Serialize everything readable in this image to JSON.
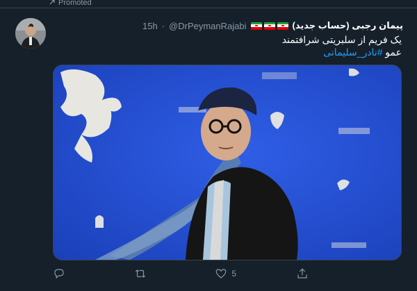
{
  "promoted": {
    "label": "Promoted"
  },
  "tweet": {
    "display_name": "پیمان رجبی (حساب جدید)",
    "handle": "@DrPeymanRajabi",
    "separator": "·",
    "time": "15h",
    "text_line1": "یک فریم از سلبریتی شرافتمند",
    "text_line2_prefix": "عمو ",
    "hashtag": "#نادر_سلیمانی",
    "like_count": "5"
  },
  "icons": {
    "reply": "reply-icon",
    "retweet": "retweet-icon",
    "like": "heart-icon",
    "share": "share-icon"
  },
  "colors": {
    "background": "#15202b",
    "hashtag": "#1da1f2",
    "muted": "#8899a6",
    "media_backdrop": "#1f47c9"
  }
}
